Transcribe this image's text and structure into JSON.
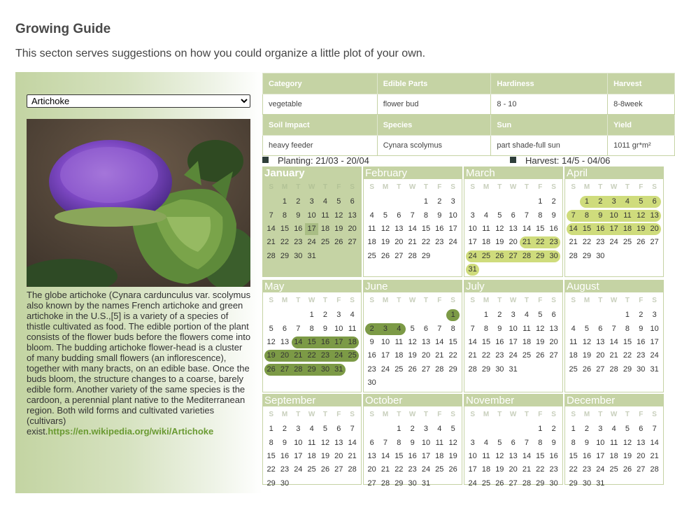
{
  "page": {
    "title": "Growing Guide",
    "description": "This secton serves suggestions on how you could organize a little plot of your own."
  },
  "plant_select": {
    "value": "Artichoke"
  },
  "photo": {
    "alt": "artichoke flower"
  },
  "description": {
    "text": "The globe artichoke (Cynara cardunculus var. scolymus also known by the names French artichoke and green artichoke in the U.S.,[5] is a variety of a species of thistle cultivated as food. The edible portion of the plant consists of the flower buds before the flowers come into bloom. The budding artichoke flower-head is a cluster of many budding small flowers (an inflorescence), together with many bracts, on an edible base. Once the buds bloom, the structure changes to a coarse, barely edible form. Another variety of the same species is the cardoon, a perennial plant native to the Mediterranean region. Both wild forms and cultivated varieties (cultivars) exist.",
    "link": "https://en.wikipedia.org/wiki/Artichoke"
  },
  "info": {
    "headers1": [
      "Category",
      "Edible Parts",
      "Hardiness",
      "Harvest"
    ],
    "values1": [
      "vegetable",
      "flower bud",
      "8 - 10",
      "8-8week"
    ],
    "headers2": [
      "Soil Impact",
      "Species",
      "Sun",
      "Yield"
    ],
    "values2": [
      "heavy feeder",
      "Cynara scolymus",
      "part shade-full sun",
      "1011 gr*m²"
    ]
  },
  "legend": {
    "planting": "Planting: 21/03 - 20/04",
    "harvest": "Harvest: 14/5 - 04/06"
  },
  "colors": {
    "planting": "#cfdc7c",
    "harvest": "#7c9a46",
    "accent": "#c5d3a4"
  },
  "calendar": {
    "dow": [
      "S",
      "M",
      "T",
      "W",
      "T",
      "F",
      "S"
    ],
    "today": "January 17",
    "months": [
      {
        "name": "January",
        "start": 1,
        "days": 31
      },
      {
        "name": "February",
        "start": 4,
        "days": 29
      },
      {
        "name": "March",
        "start": 5,
        "days": 31
      },
      {
        "name": "April",
        "start": 1,
        "days": 30
      },
      {
        "name": "May",
        "start": 3,
        "days": 31
      },
      {
        "name": "June",
        "start": 6,
        "days": 30
      },
      {
        "name": "July",
        "start": 1,
        "days": 31
      },
      {
        "name": "August",
        "start": 4,
        "days": 31
      },
      {
        "name": "September",
        "start": 0,
        "days": 30
      },
      {
        "name": "October",
        "start": 2,
        "days": 31
      },
      {
        "name": "November",
        "start": 5,
        "days": 30
      },
      {
        "name": "December",
        "start": 0,
        "days": 31
      }
    ]
  }
}
